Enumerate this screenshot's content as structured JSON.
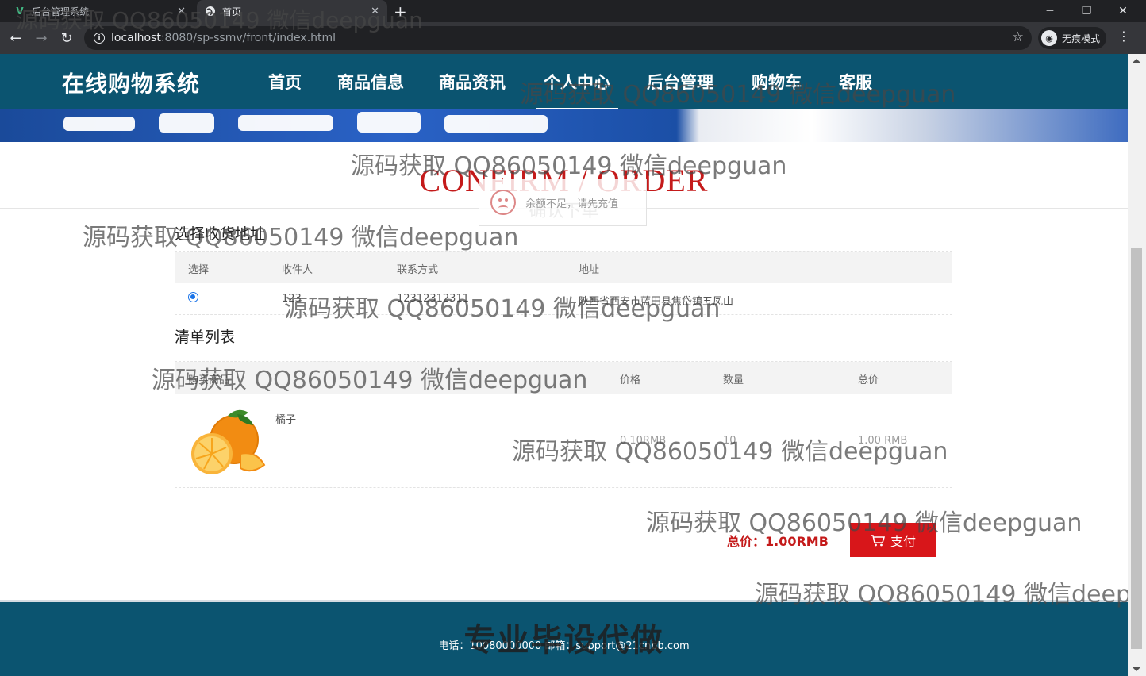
{
  "browser": {
    "tabs": [
      {
        "title": "后台管理系统",
        "active": false,
        "icon": "vue-icon"
      },
      {
        "title": "首页",
        "active": true,
        "icon": "globe-icon"
      }
    ],
    "url_host": "localhost",
    "url_rest": ":8080/sp-ssmv/front/index.html",
    "incognito_label": "无痕模式"
  },
  "site": {
    "logo": "在线购物系统",
    "nav": [
      "首页",
      "商品信息",
      "商品资讯",
      "个人中心",
      "后台管理",
      "购物车",
      "客服"
    ],
    "active_nav": "个人中心"
  },
  "confirm": {
    "title": "CONFIRM / ORDER",
    "subtitle": "确认下单"
  },
  "toast": {
    "message": "余额不足，请先充值"
  },
  "address_section": {
    "label": "选择收货地址",
    "columns": [
      "选择",
      "收件人",
      "联系方式",
      "地址"
    ],
    "rows": [
      {
        "selected": true,
        "name": "123",
        "phone": "12312312311",
        "address": "陕西省西安市蓝田县焦岱镇五凤山"
      }
    ]
  },
  "order_section": {
    "label": "清单列表",
    "columns": [
      "购买商品",
      "价格",
      "数量",
      "总价"
    ],
    "items": [
      {
        "name": "橘子",
        "price": "0.10RMB",
        "quantity": "10",
        "total": "1.00 RMB"
      }
    ]
  },
  "payment": {
    "total_label": "总价：1.00RMB",
    "pay_label": "支付"
  },
  "footer": {
    "text": "电话：10080000000   邮箱：support@21cnbb.com",
    "stamp": "专业毕设代做"
  },
  "watermark": "源码获取 QQ86050149 微信deepguan",
  "colors": {
    "header": "#0b5470",
    "accent": "#c41a1a",
    "pay_button": "#d8161a"
  }
}
